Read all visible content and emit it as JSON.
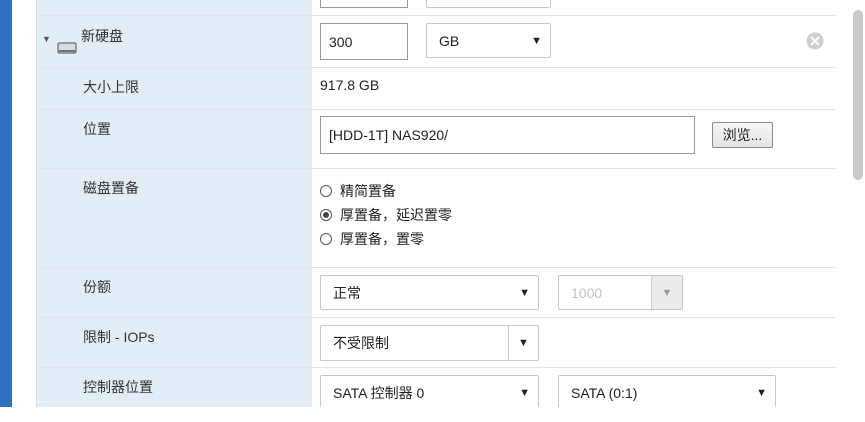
{
  "disk_row": {
    "toggle_icon": "triangle-down",
    "disk_icon": "hard-disk",
    "label": "新硬盘",
    "size_value": "300",
    "size_unit": "GB",
    "remove_icon": "circle-x"
  },
  "max_size": {
    "label": "大小上限",
    "value": "917.8 GB"
  },
  "location": {
    "label": "位置",
    "value": "[HDD-1T] NAS920/",
    "browse_label": "浏览..."
  },
  "provisioning": {
    "label": "磁盘置备",
    "options": [
      {
        "label": "精简置备",
        "selected": false
      },
      {
        "label": "厚置备，延迟置零",
        "selected": true
      },
      {
        "label": "厚置备，置零",
        "selected": false
      }
    ]
  },
  "shares": {
    "label": "份额",
    "selected": "正常",
    "value_placeholder": "1000"
  },
  "iops": {
    "label": "限制 - IOPs",
    "selected": "不受限制"
  },
  "controller": {
    "label": "控制器位置",
    "controller": "SATA 控制器 0",
    "slot": "SATA (0:1)"
  }
}
